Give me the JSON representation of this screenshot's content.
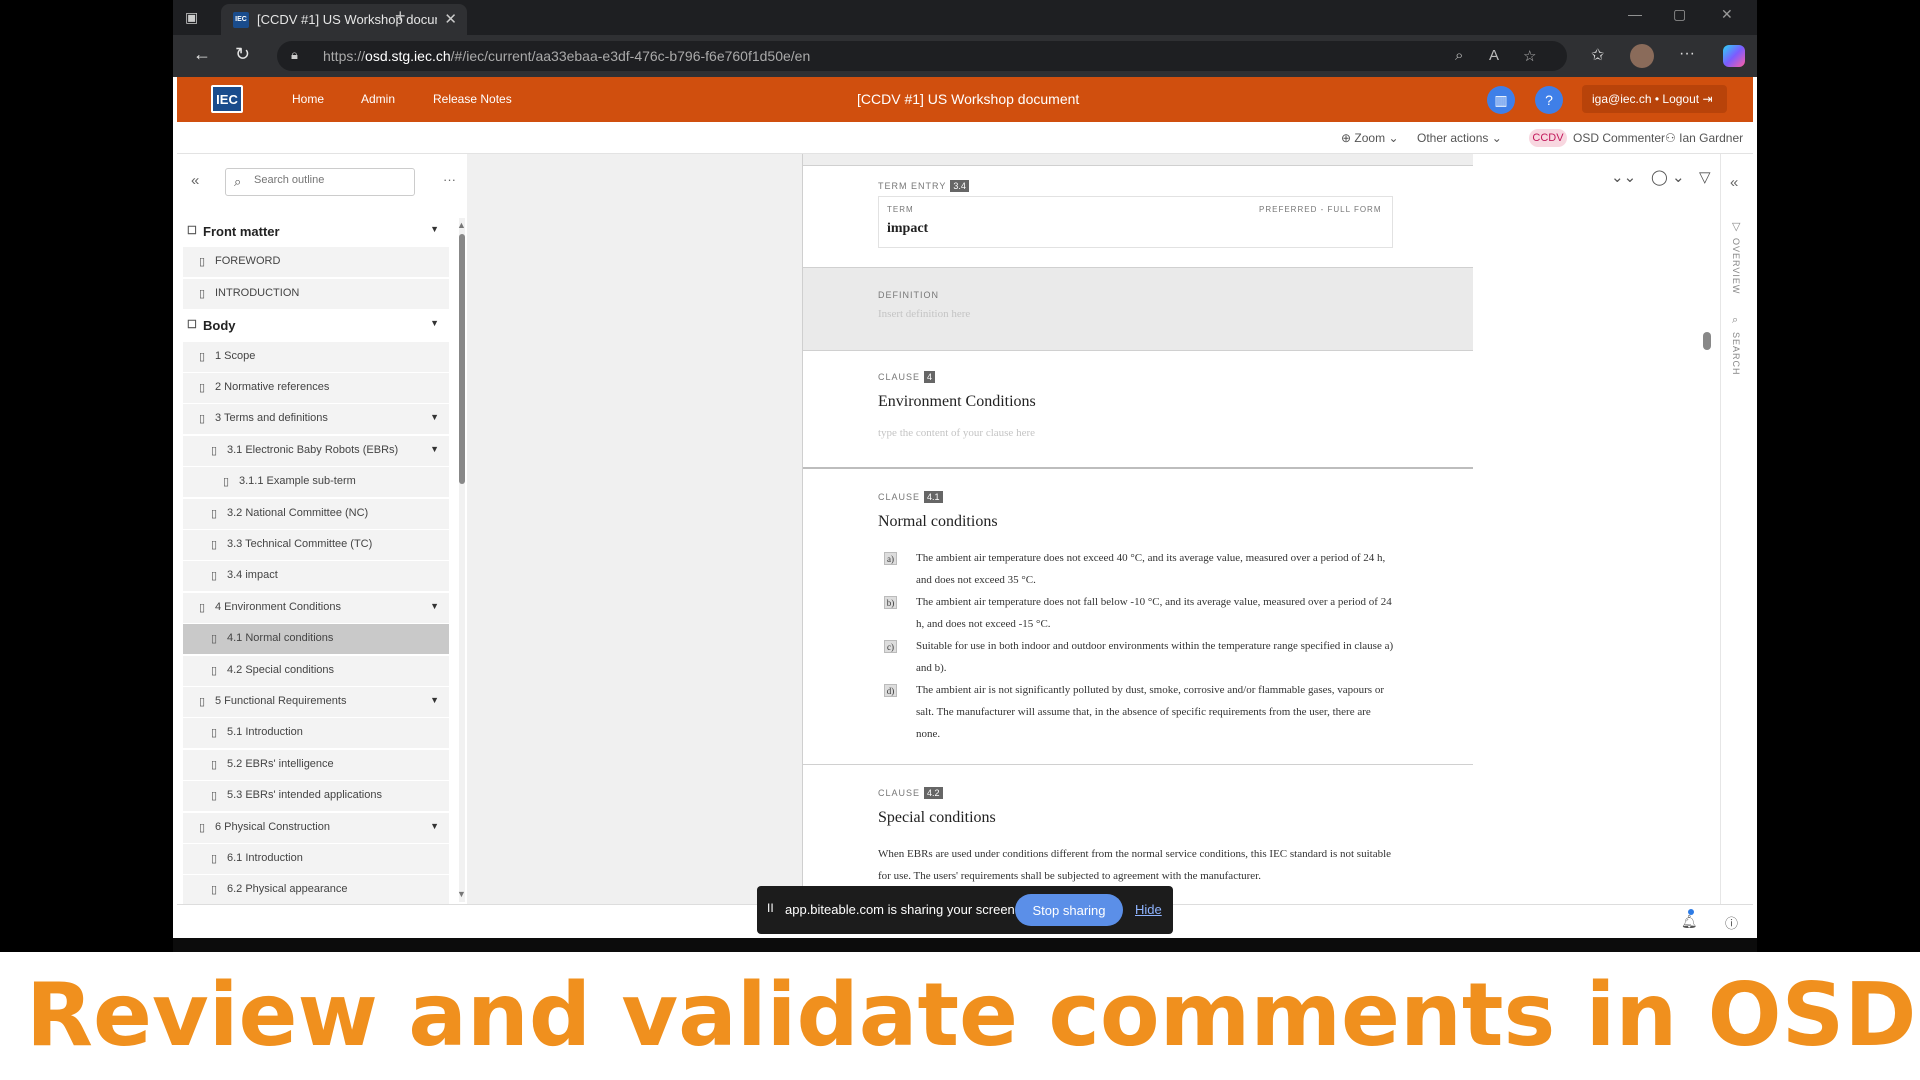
{
  "browser": {
    "tab_title": "[CCDV #1] US Workshop docume",
    "tab_favicon": "IEC",
    "url_prefix": "https://",
    "url_host": "osd.stg.iec.ch",
    "url_path": "/#/iec/current/aa33ebaa-e3df-476c-b796-f6e760f1d50e/en"
  },
  "app": {
    "logo": "IEC",
    "nav": [
      "Home",
      "Admin",
      "Release Notes"
    ],
    "doc_title": "[CCDV #1] US Workshop document",
    "user": "iga@iec.ch • Logout",
    "brand_color": "#d04f0e"
  },
  "toolbar": {
    "zoom": "Zoom",
    "other_actions": "Other actions",
    "stage_badge": "CCDV",
    "role": "OSD Commenter",
    "user_name": "Ian Gardner"
  },
  "outline": {
    "search_placeholder": "Search outline",
    "items": [
      {
        "label": "Front matter",
        "type": "group"
      },
      {
        "label": "FOREWORD",
        "type": "item"
      },
      {
        "label": "INTRODUCTION",
        "type": "item"
      },
      {
        "label": "Body",
        "type": "group"
      },
      {
        "label": "1 Scope",
        "type": "item"
      },
      {
        "label": "2 Normative references",
        "type": "item"
      },
      {
        "label": "3 Terms and definitions",
        "type": "item"
      },
      {
        "label": "3.1 Electronic Baby Robots (EBRs)",
        "type": "item"
      },
      {
        "label": "3.1.1 Example sub-term",
        "type": "item"
      },
      {
        "label": "3.2 National Committee (NC)",
        "type": "item"
      },
      {
        "label": "3.3 Technical Committee (TC)",
        "type": "item"
      },
      {
        "label": "3.4 impact",
        "type": "item"
      },
      {
        "label": "4 Environment Conditions",
        "type": "item"
      },
      {
        "label": "4.1 Normal conditions",
        "type": "item"
      },
      {
        "label": "4.2 Special conditions",
        "type": "item"
      },
      {
        "label": "5 Functional Requirements",
        "type": "item"
      },
      {
        "label": "5.1 Introduction",
        "type": "item"
      },
      {
        "label": "5.2 EBRs' intelligence",
        "type": "item"
      },
      {
        "label": "5.3 EBRs' intended applications",
        "type": "item"
      },
      {
        "label": "6 Physical Construction",
        "type": "item"
      },
      {
        "label": "6.1 Introduction",
        "type": "item"
      },
      {
        "label": "6.2 Physical appearance",
        "type": "item"
      }
    ]
  },
  "document": {
    "term_entry": {
      "kicker": "TERM ENTRY",
      "num": "3.4",
      "term_label": "TERM",
      "term_type": "PREFERRED - FULL FORM",
      "term": "impact"
    },
    "definition": {
      "kicker": "DEFINITION",
      "placeholder": "Insert definition here"
    },
    "clause4": {
      "kicker": "CLAUSE",
      "num": "4",
      "title": "Environment Conditions",
      "placeholder": "type the content of your clause here"
    },
    "clause41": {
      "kicker": "CLAUSE",
      "num": "4.1",
      "title": "Normal conditions",
      "items": [
        {
          "marker": "a)",
          "text": "The ambient air temperature does not exceed 40 °C, and its average value, measured over a period of 24 h, and does not exceed 35 °C."
        },
        {
          "marker": "b)",
          "text": "The ambient air temperature does not fall below -10 °C, and its average value, measured over a period of 24 h, and does not exceed -15 °C."
        },
        {
          "marker": "c)",
          "text": "Suitable for use in both indoor and outdoor environments within the temperature range specified in clause a) and b)."
        },
        {
          "marker": "d)",
          "text": "The ambient air is not significantly polluted by dust, smoke, corrosive and/or flammable gases, vapours or salt. The manufacturer will assume that, in the absence of specific requirements from the user, there are none."
        }
      ]
    },
    "clause42": {
      "kicker": "CLAUSE",
      "num": "4.2",
      "title": "Special conditions",
      "text": "When EBRs are used under conditions different from the normal service conditions, this IEC standard is not suitable for use. The users' requirements shall be subjected to agreement with the manufacturer."
    }
  },
  "comments_panel": {
    "rail": [
      "OVERVIEW",
      "SEARCH"
    ]
  },
  "share_bar": {
    "message": "app.biteable.com is sharing your screen.",
    "stop": "Stop sharing",
    "hide": "Hide"
  },
  "caption": "Review and validate comments in  OSD",
  "caption_color": "#f0901e"
}
